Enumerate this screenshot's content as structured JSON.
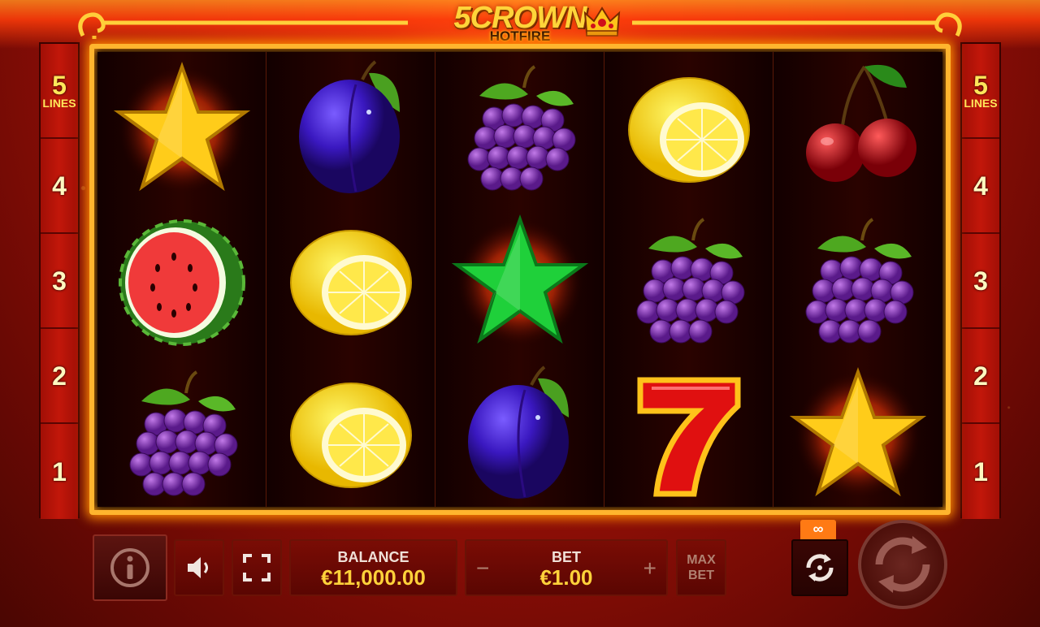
{
  "game": {
    "logo_main": "5CROWN",
    "logo_sub": "HOTFIRE"
  },
  "lines_left": [
    {
      "num": "5",
      "label": "LINES"
    },
    {
      "num": "4"
    },
    {
      "num": "3"
    },
    {
      "num": "2"
    },
    {
      "num": "1"
    }
  ],
  "lines_right": [
    {
      "num": "5",
      "label": "LINES"
    },
    {
      "num": "4"
    },
    {
      "num": "3"
    },
    {
      "num": "2"
    },
    {
      "num": "1"
    }
  ],
  "reels": [
    [
      "gold-star-icon",
      "watermelon-icon",
      "grapes-icon"
    ],
    [
      "plum-icon",
      "lemon-icon",
      "lemon-icon"
    ],
    [
      "grapes-icon",
      "green-star-icon",
      "plum-icon"
    ],
    [
      "lemon-icon",
      "grapes-icon",
      "seven-icon"
    ],
    [
      "cherry-icon",
      "grapes-icon",
      "gold-star-icon"
    ]
  ],
  "controls": {
    "info_icon": "info-icon",
    "sound_icon": "speaker-icon",
    "fullscreen_icon": "fullscreen-icon",
    "balance_label": "BALANCE",
    "balance_value": "€11,000.00",
    "bet_label": "BET",
    "bet_value": "€1.00",
    "bet_minus": "−",
    "bet_plus": "+",
    "max_bet_line1": "MAX",
    "max_bet_line2": "BET",
    "autoplay_tag": "∞",
    "autoplay_icon": "autoplay-icon",
    "spin_icon": "spin-icon"
  },
  "colors": {
    "frame": "#ffb52e",
    "value_text": "#ffd23a",
    "autoplay_tag": "#ff7a14"
  }
}
